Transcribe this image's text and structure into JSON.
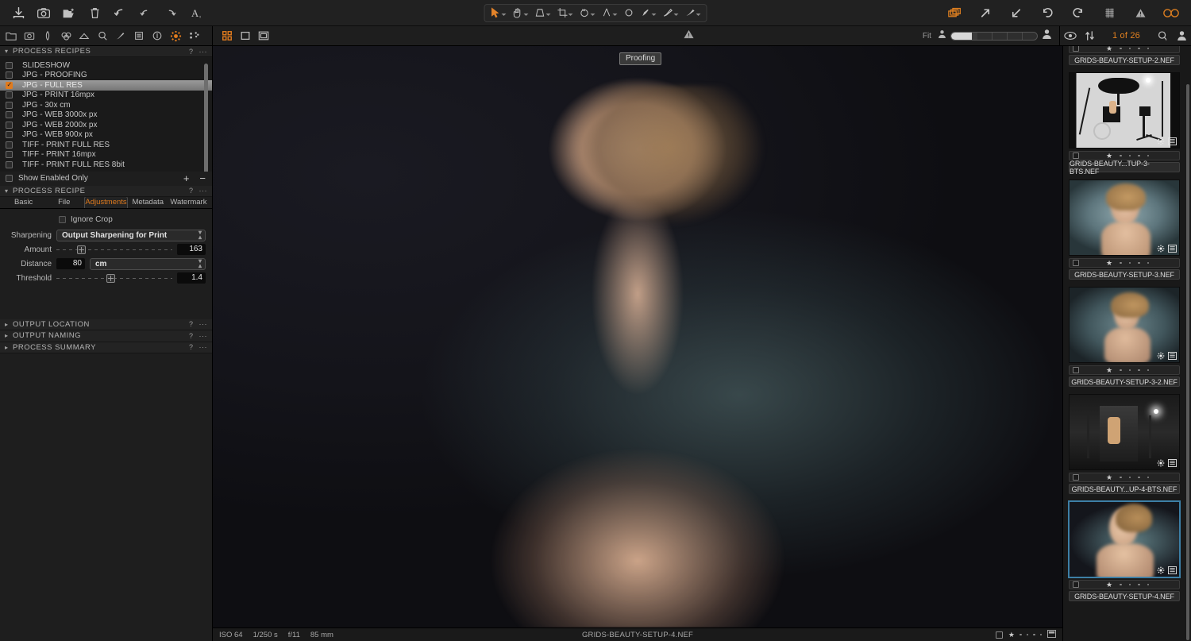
{
  "toolbar_top": {
    "left_tools": [
      {
        "name": "import-icon",
        "title": "Import"
      },
      {
        "name": "camera-icon",
        "title": "Capture"
      },
      {
        "name": "open-folder-icon",
        "title": "Open"
      },
      {
        "name": "trash-icon",
        "title": "Delete"
      },
      {
        "name": "undo-arrow-icon",
        "title": "Undo"
      },
      {
        "name": "undo-icon",
        "title": "Undo Last"
      },
      {
        "name": "redo-icon",
        "title": "Redo"
      },
      {
        "name": "text-tool-icon",
        "title": "Annotate"
      }
    ],
    "center_tools": [
      {
        "name": "cursor-select-icon",
        "title": "Select"
      },
      {
        "name": "pan-hand-icon",
        "title": "Pan"
      },
      {
        "name": "keystone-icon",
        "title": "Keystone"
      },
      {
        "name": "crop-icon",
        "title": "Crop"
      },
      {
        "name": "rotate-icon",
        "title": "Rotate"
      },
      {
        "name": "straighten-icon",
        "title": "Straighten"
      },
      {
        "name": "spot-removal-icon",
        "title": "Spot Removal"
      },
      {
        "name": "draw-mask-icon",
        "title": "Draw Mask"
      },
      {
        "name": "brush-icon",
        "title": "Brush"
      },
      {
        "name": "gradient-mask-icon",
        "title": "Gradient Mask"
      }
    ],
    "right_tools": [
      {
        "name": "copy-layers-icon",
        "title": "Copy Adjustments"
      },
      {
        "name": "apply-arrow-icon",
        "title": "Apply"
      },
      {
        "name": "import-arrow-icon",
        "title": "Get Adjustments"
      },
      {
        "name": "rotate-ccw-icon",
        "title": "Rotate Left"
      },
      {
        "name": "rotate-cw-icon",
        "title": "Rotate Right"
      },
      {
        "name": "grid-overlay-icon",
        "title": "Grid"
      },
      {
        "name": "clipping-warning-icon",
        "title": "Exposure Warning"
      },
      {
        "name": "focus-mask-icon",
        "title": "Focus Mask"
      }
    ]
  },
  "toolbar_second": {
    "panel_tools": [
      {
        "name": "library-icon"
      },
      {
        "name": "capture-icon"
      },
      {
        "name": "lens-icon"
      },
      {
        "name": "color-icon"
      },
      {
        "name": "exposure-icon"
      },
      {
        "name": "details-icon"
      },
      {
        "name": "adjustments-icon"
      },
      {
        "name": "local-adjustments-icon"
      },
      {
        "name": "metadata-icon"
      },
      {
        "name": "output-icon"
      },
      {
        "name": "batch-icon"
      }
    ],
    "view_modes": [
      {
        "name": "grid-view-icon",
        "active": true
      },
      {
        "name": "single-view-icon",
        "active": false
      },
      {
        "name": "multi-view-icon",
        "active": false
      }
    ],
    "warning_icon": "clipping-warning-icon",
    "fit_label": "Fit",
    "zoom_value": 20,
    "counter": "1 of 26",
    "right_icons": [
      "eye-icon",
      "sort-icon",
      "search-icon",
      "person-icon"
    ]
  },
  "process_recipes": {
    "title": "PROCESS RECIPES",
    "help_glyph": "?",
    "more_glyph": "···",
    "items": [
      {
        "label": "SLIDESHOW",
        "checked": false,
        "selected": false
      },
      {
        "label": "JPG - PROOFING",
        "checked": false,
        "selected": false
      },
      {
        "label": "JPG - FULL RES",
        "checked": true,
        "selected": true
      },
      {
        "label": "JPG - PRINT 16mpx",
        "checked": false,
        "selected": false
      },
      {
        "label": "JPG - 30x cm",
        "checked": false,
        "selected": false
      },
      {
        "label": "JPG - WEB 3000x px",
        "checked": false,
        "selected": false
      },
      {
        "label": "JPG - WEB 2000x px",
        "checked": false,
        "selected": false
      },
      {
        "label": "JPG - WEB 900x px",
        "checked": false,
        "selected": false
      },
      {
        "label": "TIFF - PRINT FULL RES",
        "checked": false,
        "selected": false
      },
      {
        "label": "TIFF - PRINT 16mpx",
        "checked": false,
        "selected": false
      },
      {
        "label": "TIFF - PRINT FULL RES 8bit",
        "checked": false,
        "selected": false
      }
    ],
    "show_enabled_only": {
      "label": "Show Enabled Only",
      "checked": false
    },
    "add_glyph": "+",
    "remove_glyph": "−"
  },
  "process_recipe": {
    "title": "PROCESS RECIPE",
    "tabs": [
      {
        "label": "Basic",
        "active": false
      },
      {
        "label": "File",
        "active": false
      },
      {
        "label": "Adjustments",
        "active": true
      },
      {
        "label": "Metadata",
        "active": false
      },
      {
        "label": "Watermark",
        "active": false
      }
    ],
    "ignore_crop": {
      "label": "Ignore Crop",
      "checked": false
    },
    "sharpening": {
      "label": "Sharpening",
      "value": "Output Sharpening for Print"
    },
    "amount": {
      "label": "Amount",
      "value": "163",
      "slider_pct": 18
    },
    "distance": {
      "label": "Distance",
      "value": "80",
      "unit": "cm"
    },
    "threshold": {
      "label": "Threshold",
      "value": "1.4",
      "slider_pct": 44
    }
  },
  "collapsed_sections": [
    {
      "label": "OUTPUT LOCATION"
    },
    {
      "label": "OUTPUT NAMING"
    },
    {
      "label": "PROCESS SUMMARY"
    }
  ],
  "viewer": {
    "proofing_badge": "Proofing",
    "status": {
      "iso": "ISO 64",
      "shutter": "1/250 s",
      "aperture": "f/11",
      "focal": "85 mm",
      "filename": "GRIDS-BEAUTY-SETUP-4.NEF",
      "rating": 1,
      "stars_total": 5
    }
  },
  "browser": {
    "thumbnails": [
      {
        "name": "GRIDS-BEAUTY-SETUP-2.NEF",
        "rating": 1,
        "selected": false,
        "art": "partial-top",
        "checked": false
      },
      {
        "name": "GRIDS-BEAUTY...TUP-3-BTS.NEF",
        "rating": 1,
        "selected": false,
        "art": "studio",
        "checked": false
      },
      {
        "name": "GRIDS-BEAUTY-SETUP-3.NEF",
        "rating": 1,
        "selected": false,
        "art": "portrait-a",
        "checked": false
      },
      {
        "name": "GRIDS-BEAUTY-SETUP-3-2.NEF",
        "rating": 1,
        "selected": false,
        "art": "portrait-b",
        "checked": false
      },
      {
        "name": "GRIDS-BEAUTY...UP-4-BTS.NEF",
        "rating": 1,
        "selected": false,
        "art": "dark-studio",
        "checked": false
      },
      {
        "name": "GRIDS-BEAUTY-SETUP-4.NEF",
        "rating": 1,
        "selected": true,
        "art": "main-portrait",
        "checked": false
      }
    ],
    "badge_icons": [
      "settings-gear-icon",
      "metadata-icon"
    ]
  },
  "colors": {
    "accent": "#e07b1e",
    "panel_bg": "#1e1e1e",
    "selection_blue": "#3d7fa6"
  }
}
